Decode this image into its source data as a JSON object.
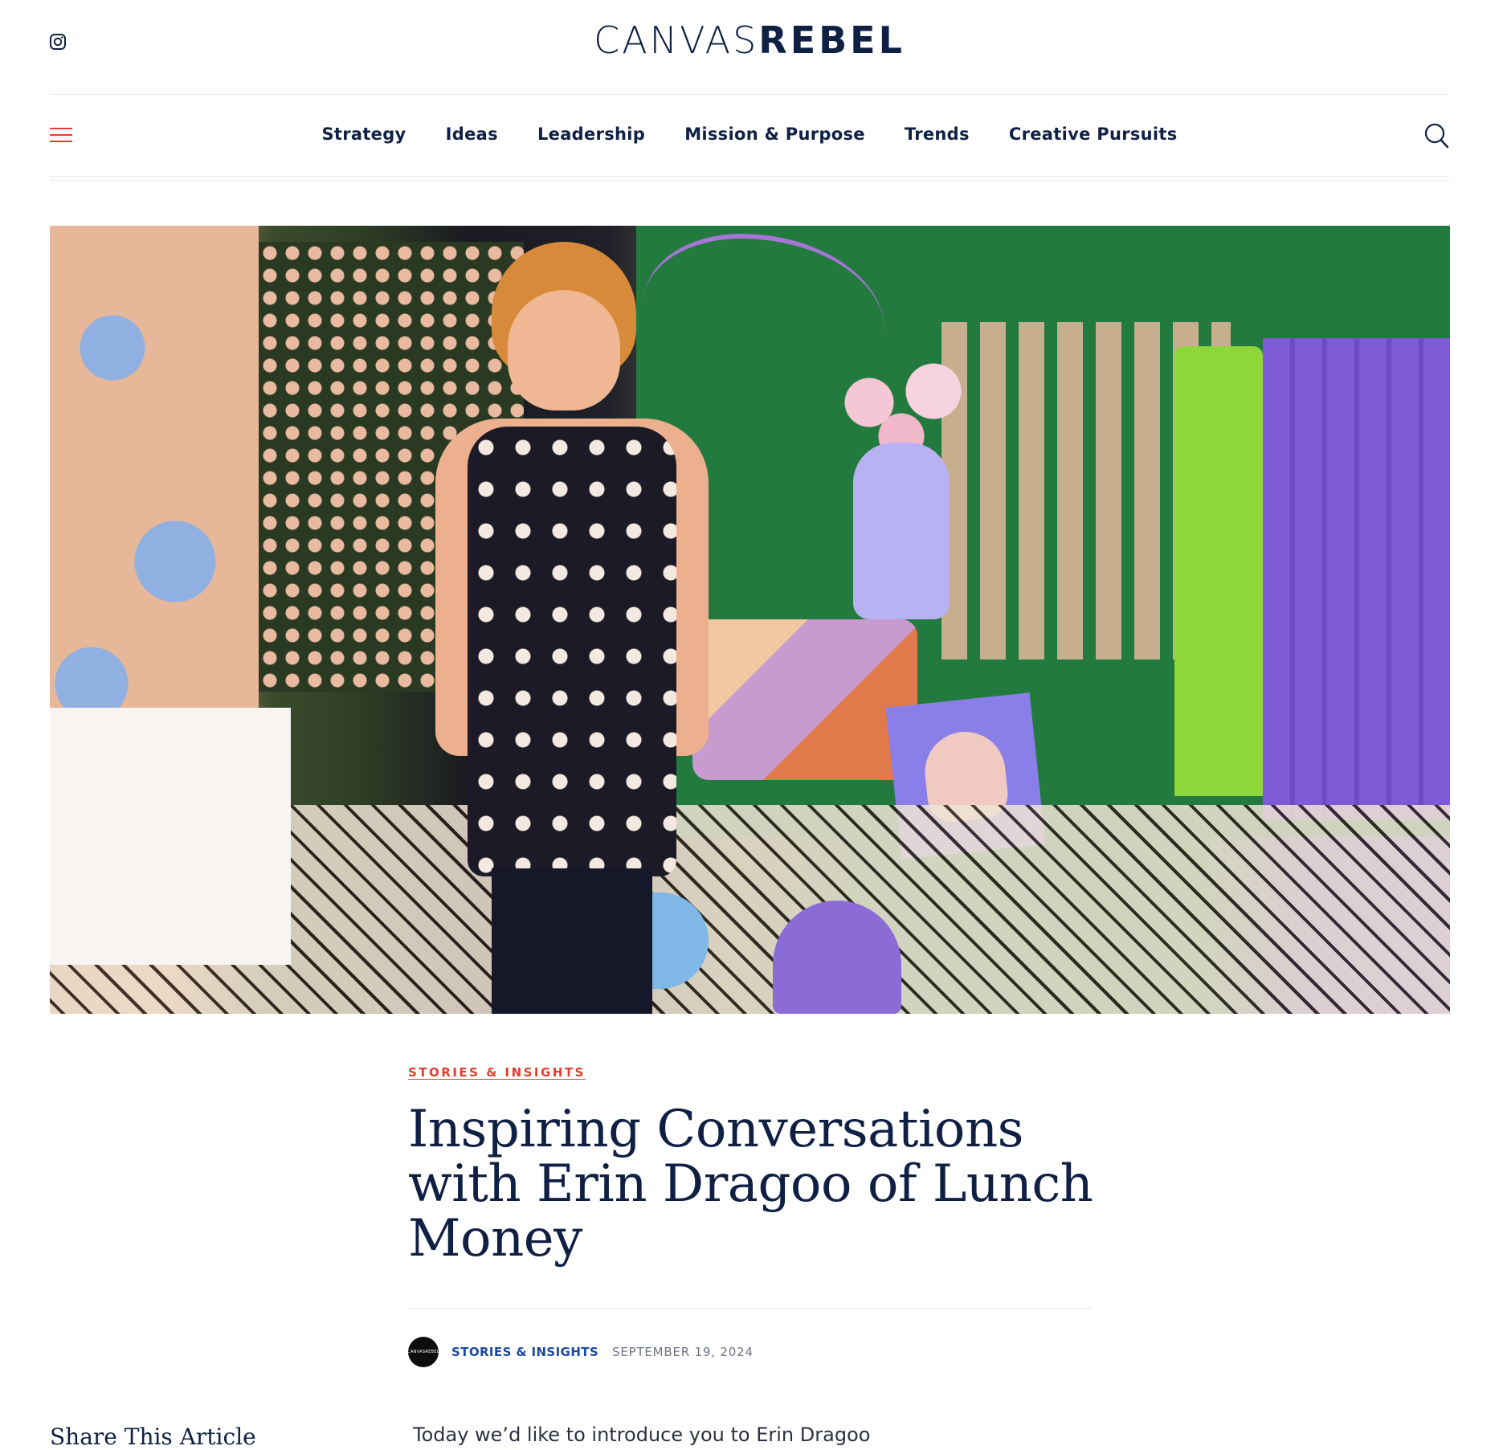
{
  "header": {
    "logo_light": "CANVAS",
    "logo_bold": "REBEL",
    "social_icon": "instagram-icon"
  },
  "nav": {
    "menu_icon": "hamburger-icon",
    "items": [
      {
        "label": "Strategy"
      },
      {
        "label": "Ideas"
      },
      {
        "label": "Leadership"
      },
      {
        "label": "Mission & Purpose"
      },
      {
        "label": "Trends"
      },
      {
        "label": "Creative Pursuits"
      }
    ],
    "search_icon": "search-icon"
  },
  "article": {
    "category": "STORIES & INSIGHTS",
    "title": "Inspiring Conversations with Erin Dragoo of Lunch Money",
    "avatar_text": "CANVASREBEL",
    "author": "STORIES & INSIGHTS",
    "date": "SEPTEMBER 19, 2024",
    "intro": "Today we’d like to introduce you to Erin Dragoo"
  },
  "sidebar": {
    "share_heading": "Share This Article"
  },
  "colors": {
    "brand_navy": "#0f2044",
    "accent_red": "#e0402e",
    "author_blue": "#1e4aa0",
    "muted_gray": "#6d7482"
  }
}
